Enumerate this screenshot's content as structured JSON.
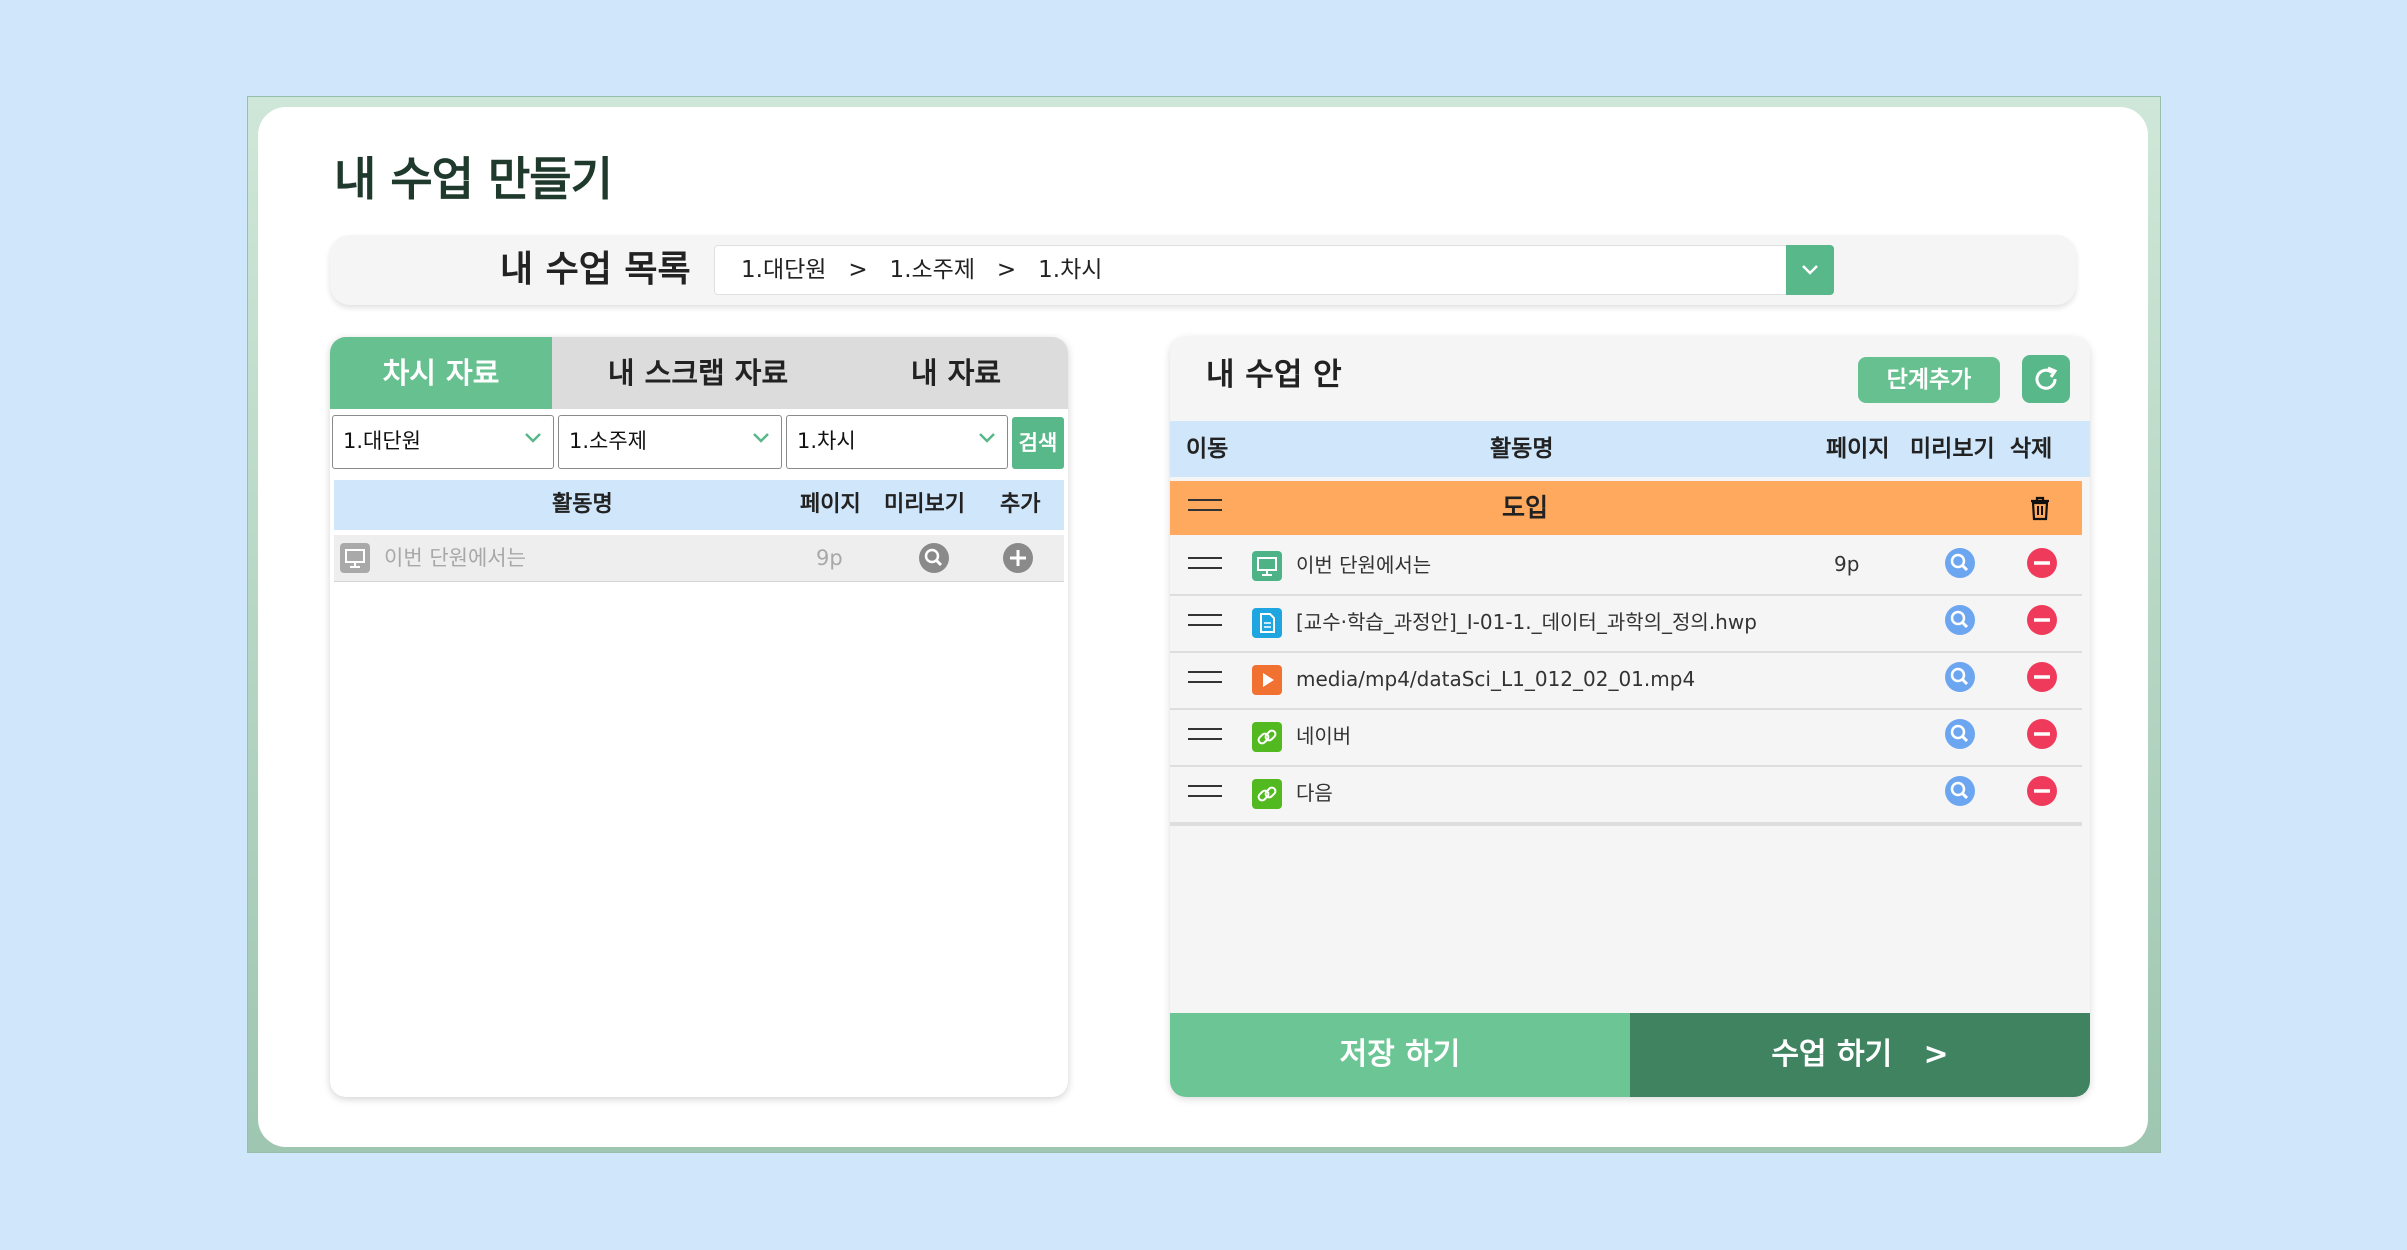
{
  "title": "내 수업 만들기",
  "lesson_list": {
    "label": "내 수업 목록",
    "selected": "1.대단원   >   1.소주제   >   1.차시"
  },
  "left_panel": {
    "tabs": [
      {
        "label": "차시 자료",
        "active": true
      },
      {
        "label": "내 스크랩 자료",
        "active": false
      },
      {
        "label": "내 자료",
        "active": false
      }
    ],
    "filters": {
      "unit": "1.대단원",
      "topic": "1.소주제",
      "session": "1.차시",
      "search_label": "검색"
    },
    "columns": {
      "name": "활동명",
      "page": "페이지",
      "preview": "미리보기",
      "add": "추가"
    },
    "rows": [
      {
        "icon": "monitor-icon",
        "name": "이번 단원에서는",
        "page": "9p"
      }
    ]
  },
  "right_panel": {
    "title": "내 수업 안",
    "add_stage_label": "단계추가",
    "columns": {
      "move": "이동",
      "name": "활동명",
      "page": "페이지",
      "preview": "미리보기",
      "delete": "삭제"
    },
    "stage": {
      "name": "도입"
    },
    "items": [
      {
        "icon": "monitor-icon",
        "name": "이번 단원에서는",
        "page": "9p"
      },
      {
        "icon": "document-icon",
        "name": "[교수·학습_과정안]_Ⅰ-01-1._데이터_과학의_정의.hwp",
        "page": ""
      },
      {
        "icon": "video-icon",
        "name": "media/mp4/dataSci_L1_012_02_01.mp4",
        "page": ""
      },
      {
        "icon": "link-icon",
        "name": "네이버",
        "page": ""
      },
      {
        "icon": "link-icon",
        "name": "다음",
        "page": ""
      }
    ],
    "save_label": "저장 하기",
    "start_label": "수업 하기   >"
  },
  "colors": {
    "background": "#cfe6fb",
    "green": "#66c08f",
    "dark_green": "#3f8360",
    "stage_orange": "#ffa95e",
    "header_blue": "#cfe6fb",
    "delete_red": "#f03a5c",
    "preview_blue": "#6da6f0"
  }
}
